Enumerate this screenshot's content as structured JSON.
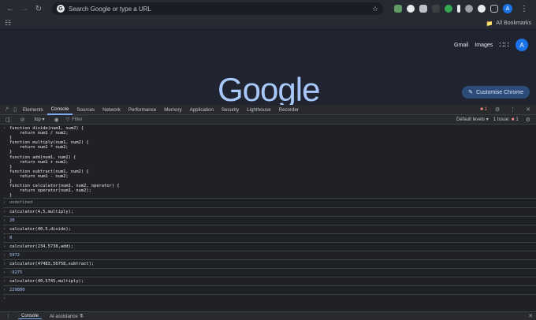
{
  "browser": {
    "omnibox_text": "Search Google or type a URL",
    "all_bookmarks": "All Bookmarks",
    "profile_initial": "A"
  },
  "google": {
    "gmail": "Gmail",
    "images": "Images",
    "avatar": "A",
    "logo": "Google",
    "customise": "Customise Chrome"
  },
  "devtools": {
    "tabs": [
      "Elements",
      "Console",
      "Sources",
      "Network",
      "Performance",
      "Memory",
      "Application",
      "Security",
      "Lighthouse",
      "Recorder"
    ],
    "active_tab": "Console",
    "error_count": "1",
    "context": "top",
    "filter_placeholder": "Filter",
    "levels": "Default levels",
    "issues": "1 Issue:",
    "issue_count": "1"
  },
  "console": {
    "code_lines": [
      "function divide(num1, num2) {",
      "    return num1 / num2;",
      "}",
      "",
      "function multiply(num1, num2) {",
      "    return num1 * num2;",
      "}",
      "",
      "function add(num1, num2) {",
      "    return num1 + num2;",
      "}",
      "",
      "function subtract(num1, num2) {",
      "    return num1 - num2;",
      "}",
      "",
      "function calculator(num1, num2, operator) {",
      "    return operator(num1, num2);",
      "}"
    ],
    "first_result": "undefined",
    "entries": [
      {
        "input": "calculator(4,5,multiply);",
        "output": "20"
      },
      {
        "input": "calculator(40,5,divide);",
        "output": "8"
      },
      {
        "input": "calculator(234,5738,add);",
        "output": "5972"
      },
      {
        "input": "calculator(47483,56758,subtract);",
        "output": "-9275"
      },
      {
        "input": "calculator(40,5745,multiply);",
        "output": "229800"
      }
    ]
  },
  "drawer": {
    "console": "Console",
    "ai": "AI assistance"
  }
}
